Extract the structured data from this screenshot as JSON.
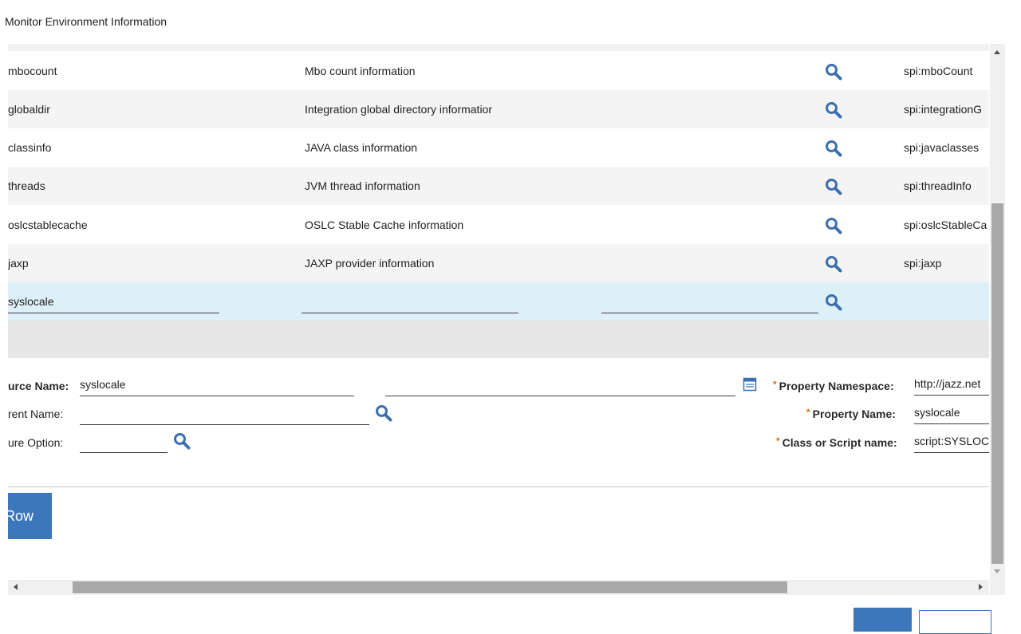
{
  "dialog": {
    "title": "Monitor Environment Information"
  },
  "table": {
    "rows": [
      {
        "name": "mbocount",
        "description": "Mbo count information",
        "class": "spi:mboCount"
      },
      {
        "name": "globaldir",
        "description": "Integration global directory informatior",
        "class": "spi:integrationG"
      },
      {
        "name": "classinfo",
        "description": "JAVA class information",
        "class": "spi:javaclasses"
      },
      {
        "name": "threads",
        "description": "JVM thread information",
        "class": "spi:threadInfo"
      },
      {
        "name": "oslcstablecache",
        "description": "OSLC Stable Cache information",
        "class": "spi:oslcStableCa"
      },
      {
        "name": "jaxp",
        "description": "JAXP provider information",
        "class": "spi:jaxp"
      }
    ],
    "selected_row": {
      "name": "syslocale",
      "description": "",
      "extra": ""
    }
  },
  "details": {
    "resource_name_label": "urce Name:",
    "resource_name_value": "syslocale",
    "resource_desc_value": "",
    "parent_name_label": "rent Name:",
    "parent_name_value": "",
    "configure_option_label": "ure Option:",
    "configure_option_value": "",
    "property_namespace_label": "Property Namespace:",
    "property_namespace_value": "http://jazz.net",
    "property_name_label": "Property Name:",
    "property_name_value": "syslocale",
    "class_script_label": "Class or Script name:",
    "class_script_value": "script:SYSLOC",
    "required_marker": "*"
  },
  "actions": {
    "new_row_label": "Row"
  },
  "colors": {
    "accent": "#3c76bb",
    "selected_row": "#ddf0f7",
    "required": "#e06b0a",
    "icon": "#3b6fb0"
  },
  "icons": [
    "magnifier-icon",
    "calendar-icon",
    "scroll-arrow-icon"
  ]
}
